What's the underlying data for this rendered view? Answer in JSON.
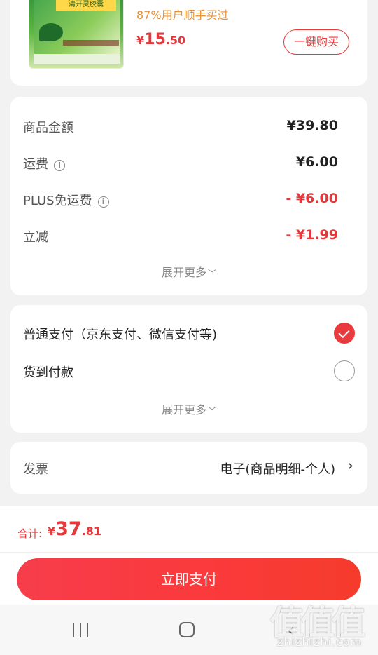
{
  "product": {
    "bought_text": "87%用户顺手买过",
    "price_symbol": "¥",
    "price_int": "15",
    "price_dec": ".50",
    "buy_button": "一键购买",
    "image_title": "清开灵胶囊"
  },
  "fees": {
    "rows": [
      {
        "label": "商品金额",
        "value": "¥39.80"
      },
      {
        "label": "运费",
        "value": "¥6.00"
      },
      {
        "label": "PLUS免运费",
        "value": "- ¥6.00"
      },
      {
        "label": "立减",
        "value": "- ¥1.99"
      }
    ],
    "expand": "展开更多",
    "expand_chevron": "﹀"
  },
  "payment": {
    "options": [
      {
        "label": "普通支付（京东支付、微信支付等)",
        "checked": true
      },
      {
        "label": "货到付款",
        "checked": false
      }
    ],
    "expand": "展开更多",
    "expand_chevron": "﹀"
  },
  "invoice": {
    "label": "发票",
    "value": "电子(商品明细-个人)",
    "arrow": "›"
  },
  "total": {
    "label": "合计:",
    "symbol": "¥",
    "int": "37",
    "dec": ".81"
  },
  "pay_button": "立即支付",
  "nav": {
    "back": "‹"
  },
  "watermark": {
    "logo": "值值值",
    "text": "zhizhizhi.com"
  },
  "colors": {
    "accent": "#e4393c",
    "bought": "#e6923b"
  }
}
